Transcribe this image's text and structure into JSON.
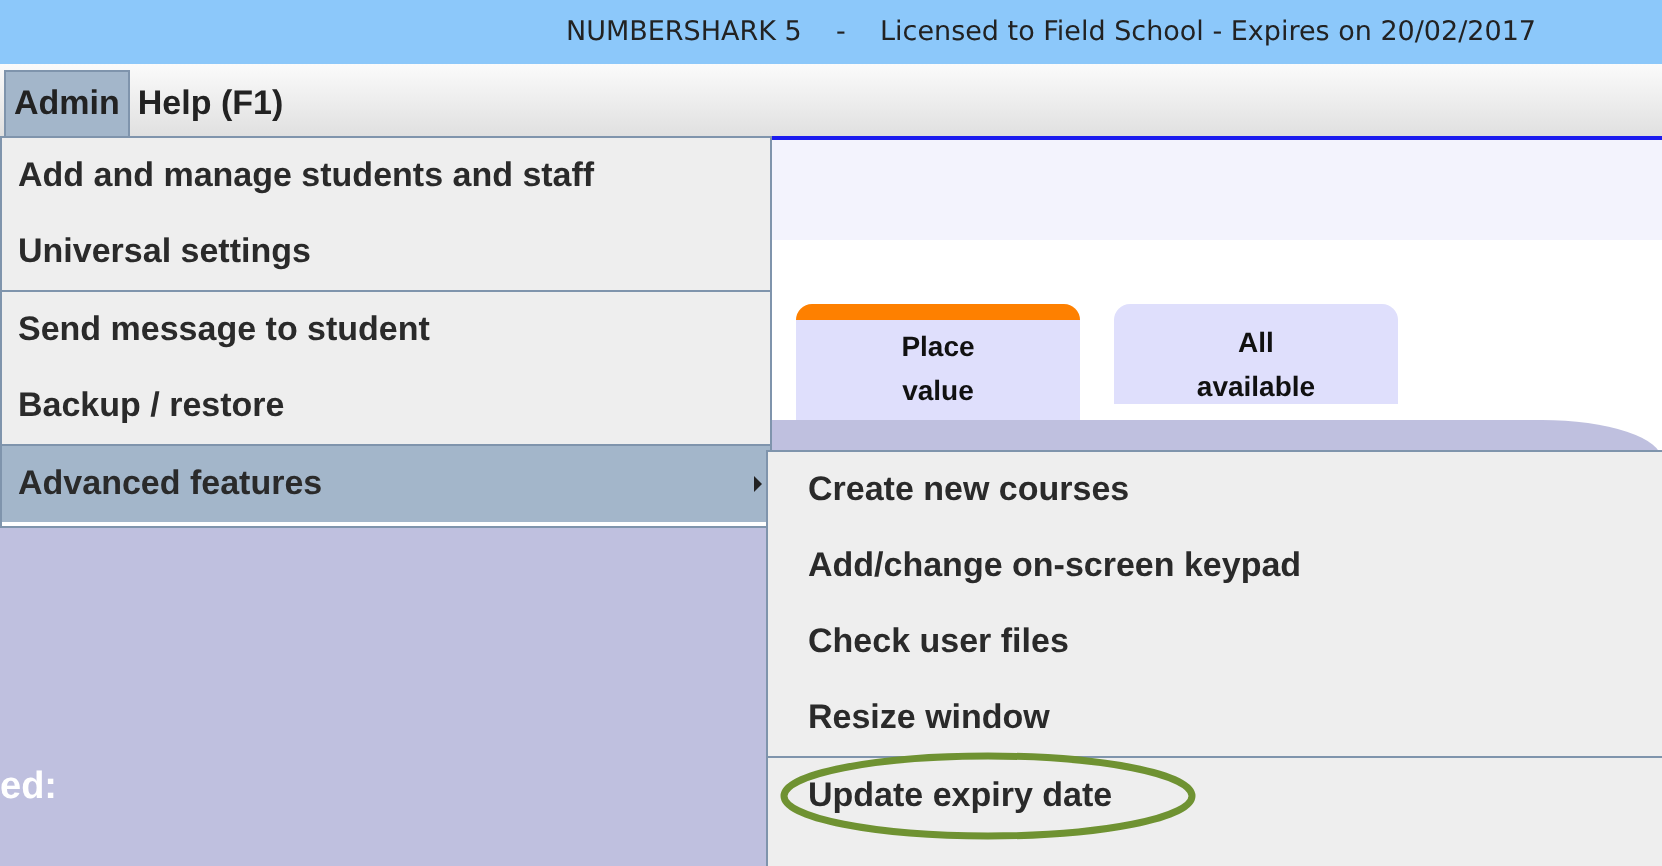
{
  "window": {
    "title": "NUMBERSHARK 5    -    Licensed to Field School - Expires on 20/02/2017"
  },
  "menubar": [
    {
      "label": "Admin",
      "selected": true
    },
    {
      "label": "Help (F1)",
      "selected": false
    }
  ],
  "tabs": [
    {
      "label": "Place value",
      "selected": true
    },
    {
      "label": "All available",
      "selected": false
    }
  ],
  "panel": {
    "label": "ed:"
  },
  "menu": [
    {
      "label": "Add and manage students and staff",
      "separator_before": false,
      "selected": false,
      "submenu": false
    },
    {
      "label": "Universal settings",
      "separator_before": false,
      "selected": false,
      "submenu": false
    },
    {
      "label": "Send message to student",
      "separator_before": true,
      "selected": false,
      "submenu": false
    },
    {
      "label": "Backup / restore",
      "separator_before": false,
      "selected": false,
      "submenu": false
    },
    {
      "label": "Advanced features",
      "separator_before": false,
      "selected": true,
      "submenu": true
    }
  ],
  "submenu": [
    {
      "label": "Create new courses",
      "separator_before": false,
      "circled": false
    },
    {
      "label": "Add/change on-screen keypad",
      "separator_before": false,
      "circled": false
    },
    {
      "label": "Check user files",
      "separator_before": false,
      "circled": false
    },
    {
      "label": "Resize window",
      "separator_before": false,
      "circled": false
    },
    {
      "label": "Update expiry date",
      "separator_before": true,
      "circled": true
    }
  ]
}
